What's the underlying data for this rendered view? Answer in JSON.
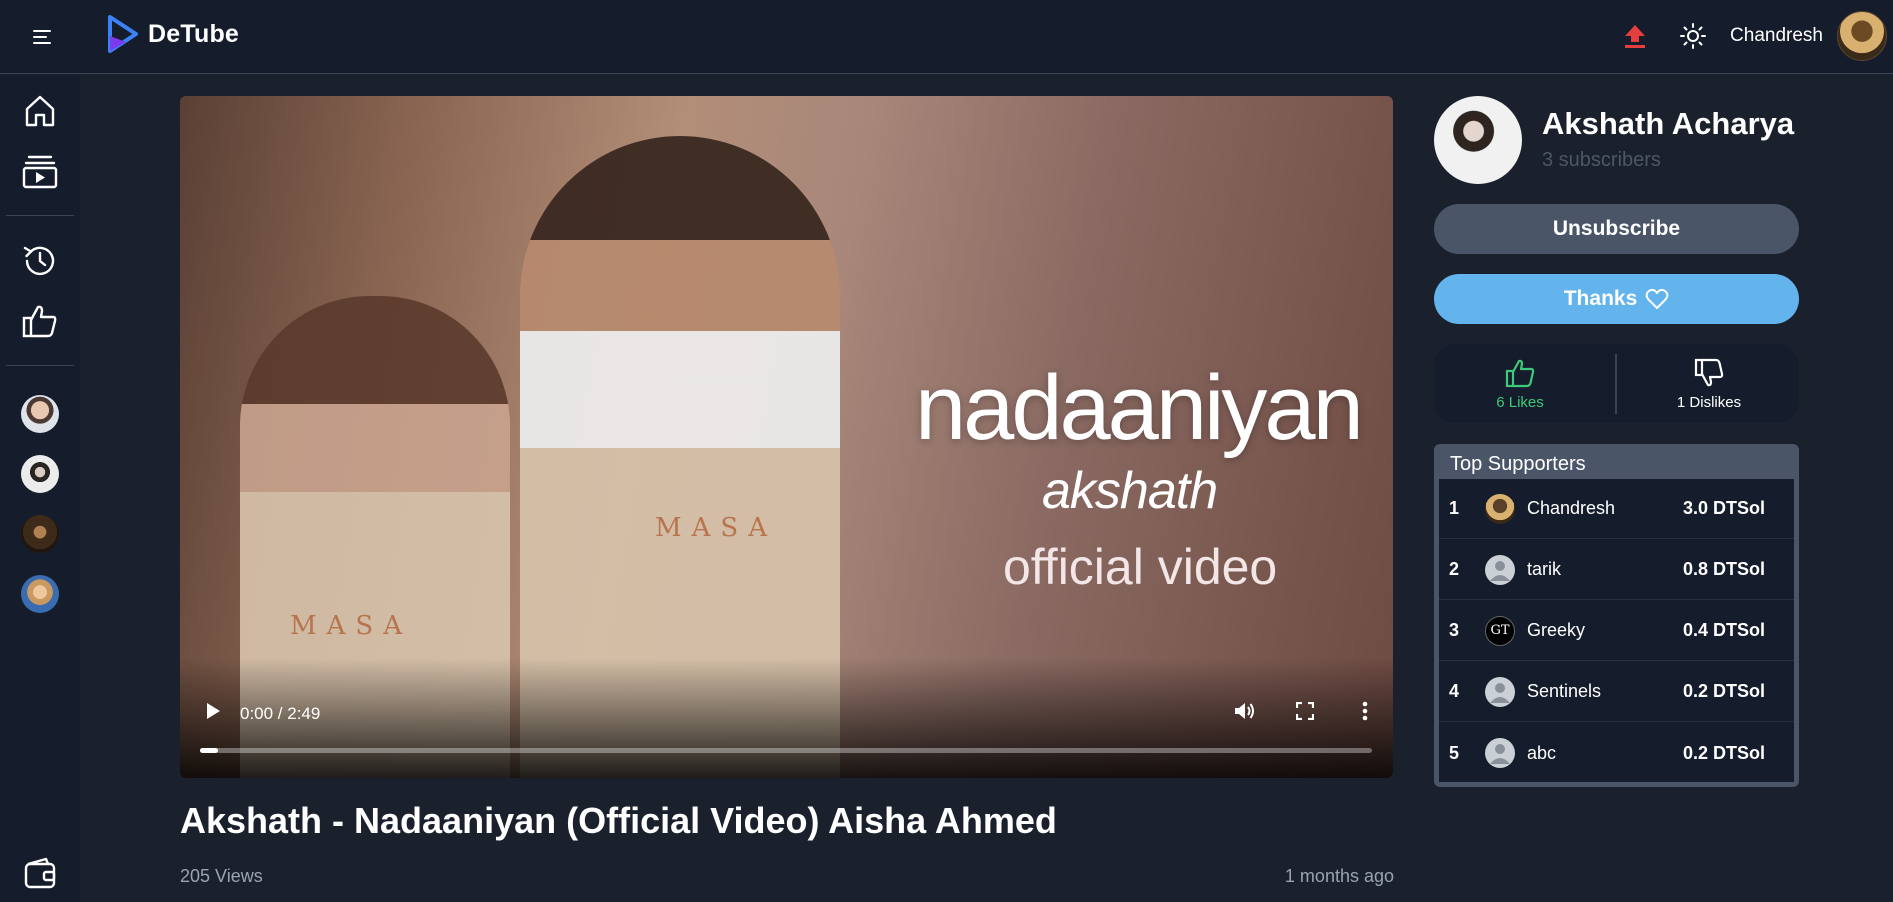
{
  "header": {
    "app_name": "DeTube",
    "username": "Chandresh",
    "colors": {
      "accent_upload": "#e53e3e",
      "logo_blue": "#3b82f6",
      "logo_purple": "#7c3aed"
    }
  },
  "sidebar": {
    "items": [
      {
        "icon": "home-icon"
      },
      {
        "icon": "subscriptions-icon"
      },
      {
        "icon": "history-icon"
      },
      {
        "icon": "liked-videos-icon"
      },
      {
        "icon": "wallet-icon"
      }
    ]
  },
  "player": {
    "overlay_title": "nadaaniyan",
    "overlay_artist": "akshath",
    "overlay_caption": "official video",
    "apron_text": "MASA",
    "time": "0:00 / 2:49",
    "progress_fraction": 0.015
  },
  "video": {
    "title": "Akshath - Nadaaniyan (Official Video) Aisha Ahmed",
    "views": "205 Views",
    "posted": "1 months ago"
  },
  "channel": {
    "name": "Akshath Acharya",
    "subscribers": "3 subscribers",
    "unsubscribe_label": "Unsubscribe",
    "thanks_label": "Thanks"
  },
  "reactions": {
    "likes": "6 Likes",
    "dislikes": "1 Dislikes"
  },
  "supporters": {
    "title": "Top Supporters",
    "rows": [
      {
        "rank": "1",
        "name": "Chandresh",
        "amount": "3.0 DTSol"
      },
      {
        "rank": "2",
        "name": "tarik",
        "amount": "0.8 DTSol"
      },
      {
        "rank": "3",
        "name": "Greeky",
        "amount": "0.4 DTSol",
        "initials": "GT"
      },
      {
        "rank": "4",
        "name": "Sentinels",
        "amount": "0.2 DTSol"
      },
      {
        "rank": "5",
        "name": "abc",
        "amount": "0.2 DTSol"
      }
    ]
  }
}
